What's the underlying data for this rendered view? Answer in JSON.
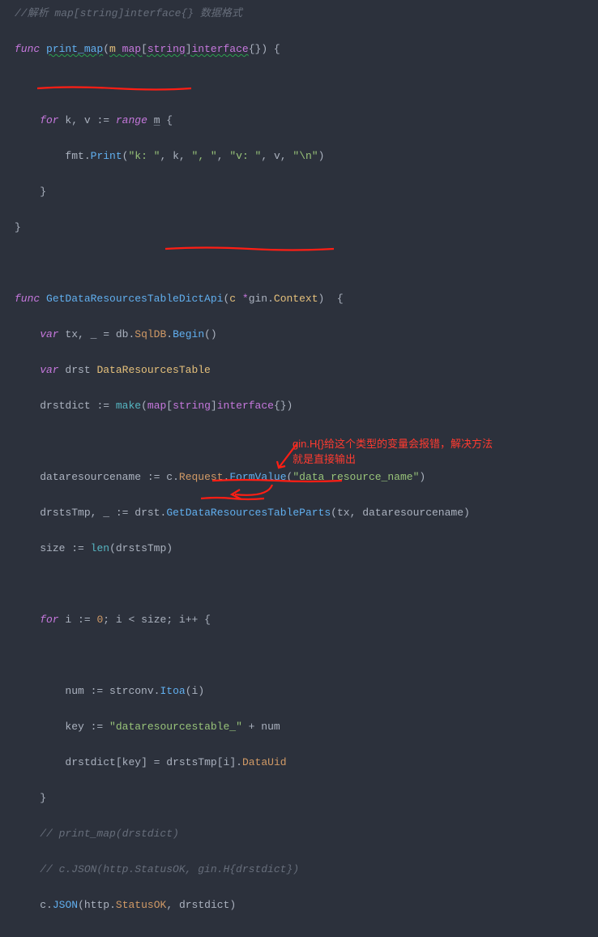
{
  "code": {
    "l01_comment": "//解析 map[string]interface{} 数据格式",
    "l02": {
      "a": "func ",
      "b": "print_map",
      "c": "(",
      "d": "m ",
      "e": "map",
      "f": "[",
      "g": "string",
      "h": "]",
      "i": "interface",
      "j": "{}) {"
    },
    "l04": {
      "a": "    for ",
      "b": "k",
      "c": ", ",
      "d": "v",
      "e": " := ",
      "f": "range ",
      "g": "m",
      "h": " {"
    },
    "l05": {
      "a": "        ",
      "b": "fmt",
      "c": ".",
      "d": "Print",
      "e": "(",
      "s1": "\"k: \"",
      "f": ", ",
      "g": "k",
      "h": ", ",
      "s2": "\", \"",
      "i": ", ",
      "s3": "\"v: \"",
      "j": ", ",
      "k": "v",
      "l": ", ",
      "s4": "\"\\n\"",
      "m": ")"
    },
    "l06": "    }",
    "l07": "}",
    "l09": {
      "a": "func ",
      "b": "GetDataResourcesTableDictApi",
      "c": "(",
      "d": "c ",
      "e": "*",
      "f": "gin",
      "g": ".",
      "h": "Context",
      "i": ")  {"
    },
    "l10": {
      "a": "    var ",
      "b": "tx",
      "c": ", ",
      "d": "_",
      "e": " = ",
      "f": "db",
      "g": ".",
      "h": "SqlDB",
      "i": ".",
      "j": "Begin",
      "k": "()"
    },
    "l11": {
      "a": "    var ",
      "b": "drst ",
      "c": "DataResourcesTable"
    },
    "l12": {
      "a": "    ",
      "b": "drstdict",
      "c": " := ",
      "d": "make",
      "e": "(",
      "f": "map",
      "g": "[",
      "h": "string",
      "i": "]",
      "j": "interface",
      "k": "{})"
    },
    "l14": {
      "a": "    ",
      "b": "dataresourcename",
      "c": " := ",
      "d": "c",
      "e": ".",
      "f": "Request",
      "g": ".",
      "h": "FormValue",
      "i": "(",
      "s": "\"data_resource_name\"",
      "j": ")"
    },
    "l15": {
      "a": "    ",
      "b": "drstsTmp",
      "c": ", ",
      "d": "_",
      "e": " := ",
      "f": "drst",
      "g": ".",
      "h": "GetDataResourcesTableParts",
      "i": "(",
      "j": "tx",
      "k": ", ",
      "l": "dataresourcename",
      "m": ")"
    },
    "l16": {
      "a": "    ",
      "b": "size",
      "c": " := ",
      "d": "len",
      "e": "(",
      "f": "drstsTmp",
      "g": ")"
    },
    "l18": {
      "a": "    for ",
      "b": "i",
      "c": " := ",
      "d": "0",
      "e": "; ",
      "f": "i",
      "g": " < ",
      "h": "size",
      "i": "; ",
      "j": "i",
      "k": "++ {"
    },
    "l20": {
      "a": "        ",
      "b": "num",
      "c": " := ",
      "d": "strconv",
      "e": ".",
      "f": "Itoa",
      "g": "(",
      "h": "i",
      "i": ")"
    },
    "l21": {
      "a": "        ",
      "b": "key",
      "c": " := ",
      "s": "\"dataresourcestable_\"",
      "d": " + ",
      "e": "num"
    },
    "l22": {
      "a": "        ",
      "b": "drstdict",
      "c": "[",
      "d": "key",
      "e": "] = ",
      "f": "drstsTmp",
      "g": "[",
      "h": "i",
      "i": "].",
      "j": "DataUid"
    },
    "l23": "    }",
    "l24_comment": "    // print_map(drstdict)",
    "l25_comment": "    // c.JSON(http.StatusOK, gin.H{drstdict})",
    "l26": {
      "a": "    ",
      "b": "c",
      "c": ".",
      "d": "JSON",
      "e": "(",
      "f": "http",
      "g": ".",
      "h": "StatusOK",
      "i": ", ",
      "j": "drstdict",
      "k": ")"
    }
  },
  "annotation": {
    "line1": "gin.H{}给这个类型的变量会报错，解决方法",
    "line2": "就是直接输出"
  }
}
